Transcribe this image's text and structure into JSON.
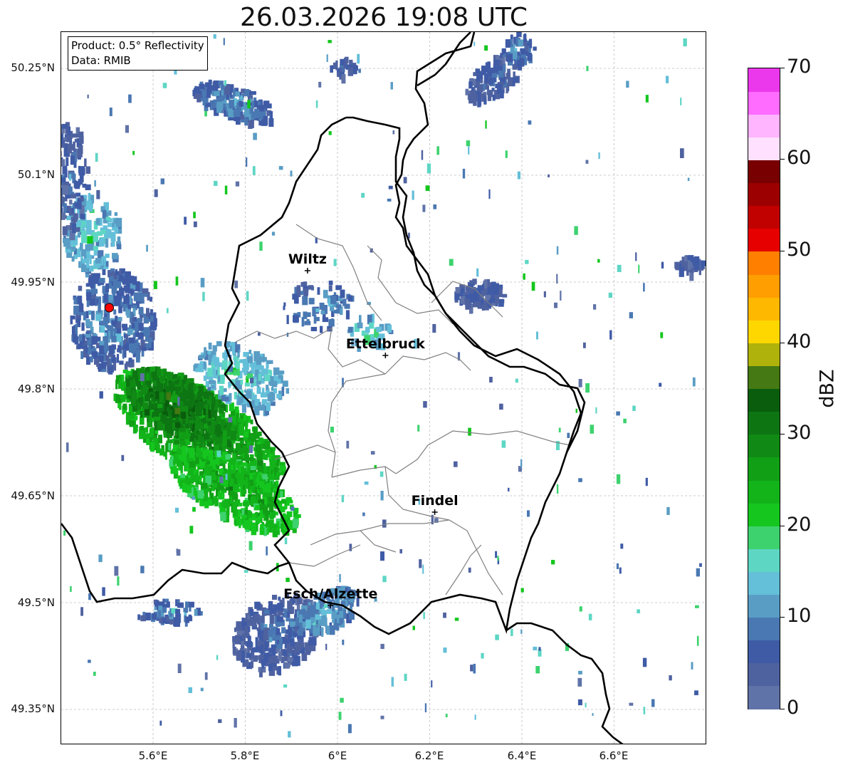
{
  "title": "26.03.2026 19:08 UTC",
  "info": {
    "product": "Product: 0.5° Reflectivity",
    "data": "Data: RMIB"
  },
  "lat_labels": [
    "50.25°N",
    "50.1°N",
    "49.95°N",
    "49.8°N",
    "49.65°N",
    "49.5°N",
    "49.35°N"
  ],
  "lon_labels": [
    "5.6°E",
    "5.8°E",
    "6°E",
    "6.2°E",
    "6.4°E",
    "6.6°E"
  ],
  "cities": [
    {
      "name": "Wiltz",
      "lon": 5.935,
      "lat": 49.966
    },
    {
      "name": "Ettelbruck",
      "lon": 6.104,
      "lat": 49.847
    },
    {
      "name": "Findel",
      "lon": 6.211,
      "lat": 49.627
    },
    {
      "name": "Esch/Alzette",
      "lon": 5.985,
      "lat": 49.496
    }
  ],
  "radar_site": {
    "lon": 5.505,
    "lat": 49.914,
    "color": "#ff0000"
  },
  "colorbar": {
    "label": "dBZ",
    "ticks": [
      "0",
      "10",
      "20",
      "30",
      "40",
      "50",
      "60",
      "70"
    ],
    "colors": [
      "#6073a8",
      "#4f62a0",
      "#3f5ba6",
      "#4a78b2",
      "#599dc5",
      "#64bfd9",
      "#5ed6c4",
      "#3dd26e",
      "#14c61e",
      "#12b41a",
      "#119f16",
      "#108a14",
      "#0d7613",
      "#0a5d0d",
      "#447913",
      "#aeb20a",
      "#ffd700",
      "#ffb800",
      "#ff9e00",
      "#ff7f00",
      "#e60000",
      "#c10000",
      "#9d0000",
      "#780000",
      "#ffe1ff",
      "#ffb5ff",
      "#ff6cff",
      "#ec38ec"
    ]
  }
}
